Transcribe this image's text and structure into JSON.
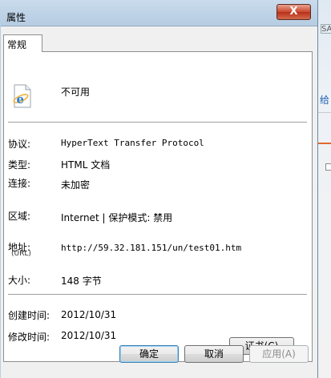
{
  "window": {
    "title": "属性",
    "close_glyph": "X"
  },
  "background": {
    "sa_text": "SA",
    "link_text": "给"
  },
  "tabs": [
    {
      "label": "常规"
    }
  ],
  "general": {
    "name": "不可用",
    "protocol_label": "协议:",
    "protocol_value": "HyperText Transfer Protocol",
    "type_label": "类型:",
    "type_value": "HTML 文档",
    "connection_label": "连接:",
    "connection_value": "未加密",
    "zone_label": "区域:",
    "zone_value": "Internet | 保护模式: 禁用",
    "address_label": "地址:",
    "address_sublabel": "(URL)",
    "address_value": "http://59.32.181.151/un/test01.htm",
    "size_label": "大小:",
    "size_value": "148 字节",
    "created_label": "创建时间:",
    "created_value": "2012/10/31",
    "modified_label": "修改时间:",
    "modified_value": "2012/10/31",
    "cert_button": "证书(C)"
  },
  "buttons": {
    "ok": "确定",
    "cancel": "取消",
    "apply": "应用(A)"
  }
}
